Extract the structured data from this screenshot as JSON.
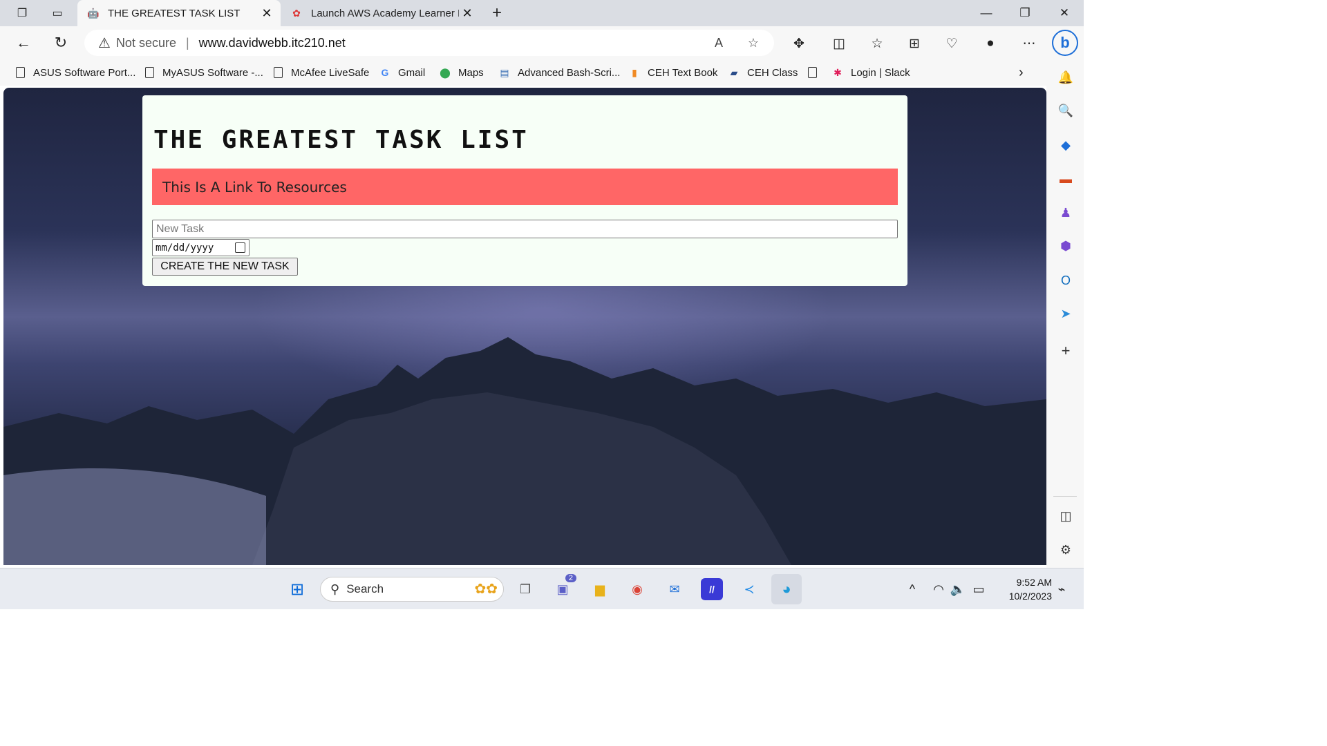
{
  "tabs": [
    {
      "title": "THE GREATEST TASK LIST",
      "active": true
    },
    {
      "title": "Launch AWS Academy Learner La",
      "active": false
    }
  ],
  "addressbar": {
    "security_label": "Not secure",
    "url": "www.davidwebb.itc210.net"
  },
  "favorites": [
    {
      "label": "ASUS Software Port...",
      "icon": "document-icon"
    },
    {
      "label": "MyASUS Software -...",
      "icon": "document-icon"
    },
    {
      "label": "McAfee LiveSafe",
      "icon": "document-icon"
    },
    {
      "label": "Gmail",
      "icon": "google-icon"
    },
    {
      "label": "Maps",
      "icon": "maps-pin-icon"
    },
    {
      "label": "Advanced Bash-Scri...",
      "icon": "window-icon"
    },
    {
      "label": "CEH Text Book",
      "icon": "book-icon"
    },
    {
      "label": "CEH Class",
      "icon": "notebook-icon"
    },
    {
      "label": "",
      "icon": "document-icon"
    },
    {
      "label": "Login | Slack",
      "icon": "slack-icon"
    }
  ],
  "page": {
    "heading": "THE GREATEST TASK LIST",
    "resource_link": "This Is A Link To Resources",
    "task_placeholder": "New Task",
    "date_placeholder": "mm/dd/yyyy",
    "create_button": "CREATE THE NEW TASK"
  },
  "taskbar": {
    "search_label": "Search",
    "teams_badge": "2",
    "time": "9:52 AM",
    "date": "10/2/2023"
  },
  "colors": {
    "banner": "#ff6666",
    "card": "#f7fff7",
    "edge_accent": "#1e6fd8"
  }
}
